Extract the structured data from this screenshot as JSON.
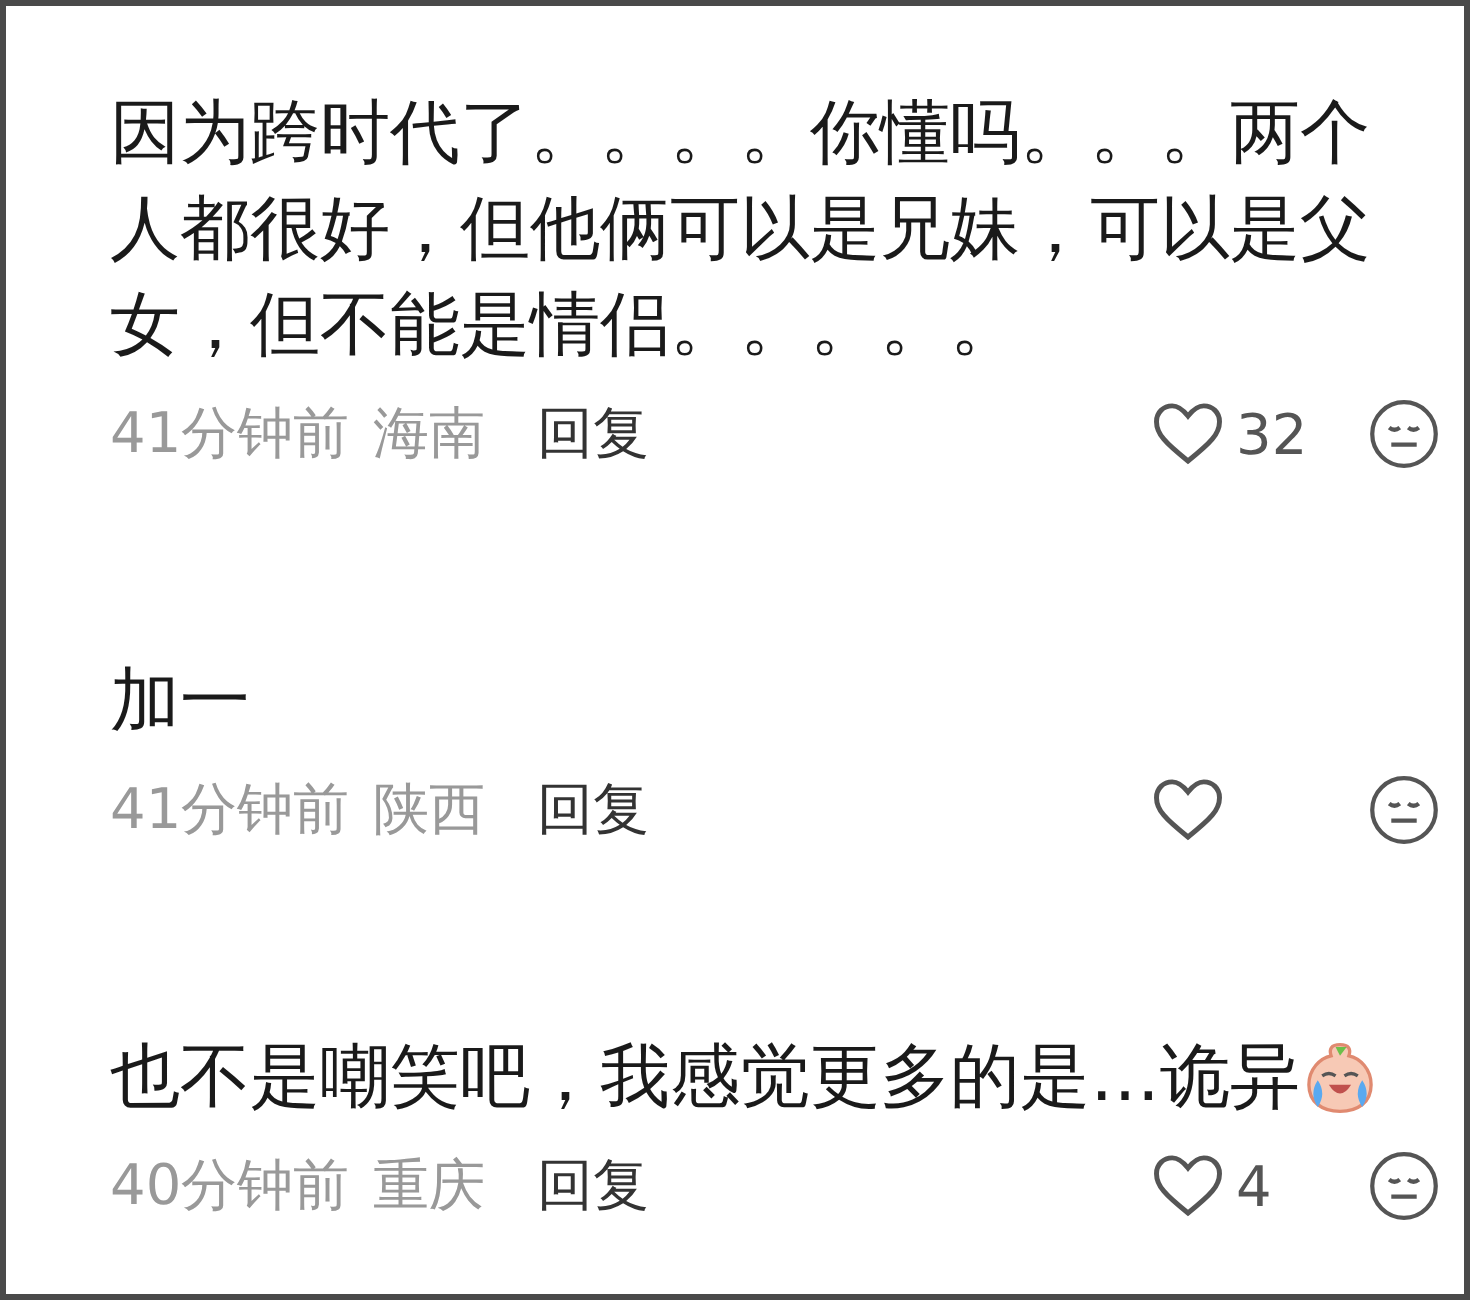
{
  "comments": [
    {
      "text": "因为跨时代了。。。。你懂吗。。。两个人都很好，但他俩可以是兄妹，可以是父女，但不能是情侣。。。。。",
      "time": "41分钟前",
      "location": "海南",
      "reply": "回复",
      "likes": "32",
      "emoji": false
    },
    {
      "text": "加一",
      "time": "41分钟前",
      "location": "陕西",
      "reply": "回复",
      "emoji": false
    },
    {
      "text": "也不是嘲笑吧，我感觉更多的是…诡异",
      "time": "40分钟前",
      "location": "重庆",
      "reply": "回复",
      "likes": "4",
      "emoji": true
    }
  ]
}
